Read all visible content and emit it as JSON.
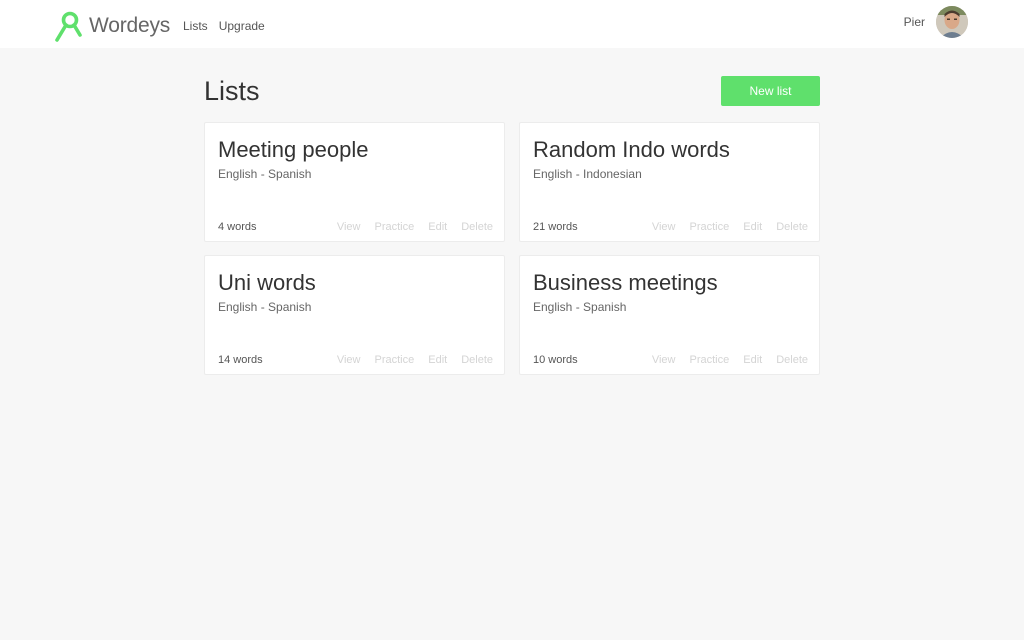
{
  "colors": {
    "accent": "#5fe06c",
    "background": "#f7f7f7",
    "card": "#ffffff",
    "action_text": "#d4d4d4"
  },
  "header": {
    "brand_name": "Wordeys",
    "logo_icon": "ribbon-icon",
    "nav": {
      "lists": "Lists",
      "upgrade": "Upgrade"
    },
    "user_name": "Pier",
    "avatar_icon": "avatar-photo"
  },
  "page": {
    "title": "Lists",
    "new_list_label": "New list"
  },
  "lists": [
    {
      "title": "Meeting people",
      "languages": "English - Spanish",
      "count": "4 words",
      "actions": {
        "view": "View",
        "practice": "Practice",
        "edit": "Edit",
        "delete": "Delete"
      }
    },
    {
      "title": "Random Indo words",
      "languages": "English - Indonesian",
      "count": "21 words",
      "actions": {
        "view": "View",
        "practice": "Practice",
        "edit": "Edit",
        "delete": "Delete"
      }
    },
    {
      "title": "Uni words",
      "languages": "English - Spanish",
      "count": "14 words",
      "actions": {
        "view": "View",
        "practice": "Practice",
        "edit": "Edit",
        "delete": "Delete"
      }
    },
    {
      "title": "Business meetings",
      "languages": "English - Spanish",
      "count": "10 words",
      "actions": {
        "view": "View",
        "practice": "Practice",
        "edit": "Edit",
        "delete": "Delete"
      }
    }
  ]
}
